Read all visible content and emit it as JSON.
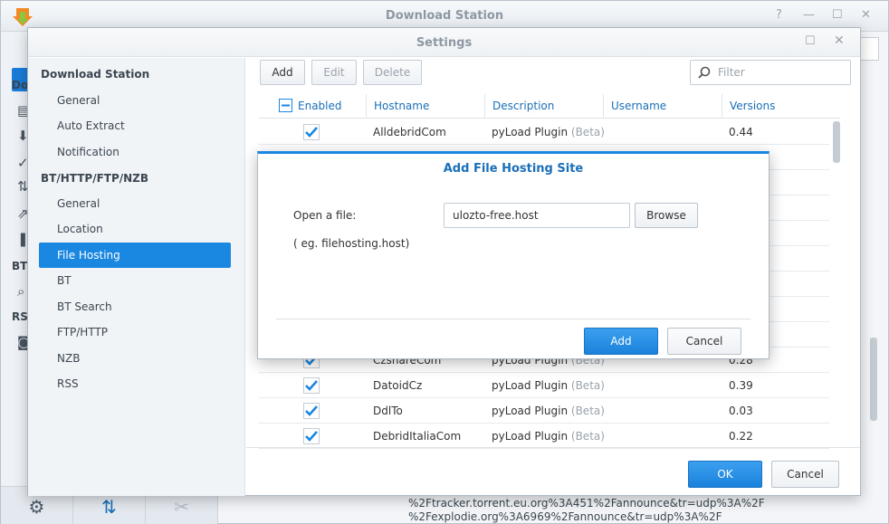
{
  "background_window": {
    "title": "Download Station",
    "sidebar_labels": [
      "Do",
      "BT",
      "RS"
    ],
    "log_lines": [
      "%2Ftracker.torrent.eu.org%3A451%2Fannounce&tr=udp%3A%2F",
      "%2Fexplodie.org%3A6969%2Fannounce&tr=udp%3A%2F"
    ]
  },
  "settings": {
    "title": "Settings",
    "nav": {
      "section1": "Download Station",
      "section1_items": [
        "General",
        "Auto Extract",
        "Notification"
      ],
      "section2": "BT/HTTP/FTP/NZB",
      "section2_items": [
        "General",
        "Location",
        "File Hosting",
        "BT",
        "BT Search",
        "FTP/HTTP",
        "NZB",
        "RSS"
      ],
      "active": "File Hosting"
    },
    "toolbar": {
      "add": "Add",
      "edit": "Edit",
      "delete": "Delete",
      "filter_placeholder": "Filter"
    },
    "grid": {
      "columns": [
        "Enabled",
        "Hostname",
        "Description",
        "Username",
        "Versions"
      ],
      "rows": [
        {
          "enabled": true,
          "hostname": "AlldebridCom",
          "description": "pyLoad Plugin",
          "tag": "(Beta)",
          "username": "",
          "version": "0.44"
        },
        {
          "enabled": true,
          "hostname": "CzshareCom",
          "description": "pyLoad Plugin",
          "tag": "(Beta)",
          "username": "",
          "version": "0.28"
        },
        {
          "enabled": true,
          "hostname": "DatoidCz",
          "description": "pyLoad Plugin",
          "tag": "(Beta)",
          "username": "",
          "version": "0.39"
        },
        {
          "enabled": true,
          "hostname": "DdlTo",
          "description": "pyLoad Plugin",
          "tag": "(Beta)",
          "username": "",
          "version": "0.03"
        },
        {
          "enabled": true,
          "hostname": "DebridItaliaCom",
          "description": "pyLoad Plugin",
          "tag": "(Beta)",
          "username": "",
          "version": "0.22"
        }
      ]
    },
    "footer": {
      "ok": "OK",
      "cancel": "Cancel"
    }
  },
  "modal": {
    "title": "Add File Hosting Site",
    "open_file_label": "Open a file:",
    "file_value": "ulozto-free.host",
    "browse": "Browse",
    "hint": "( eg. filehosting.host)",
    "add": "Add",
    "cancel": "Cancel"
  },
  "colors": {
    "accent": "#1a87e1",
    "header_text": "#1a6fb8"
  }
}
